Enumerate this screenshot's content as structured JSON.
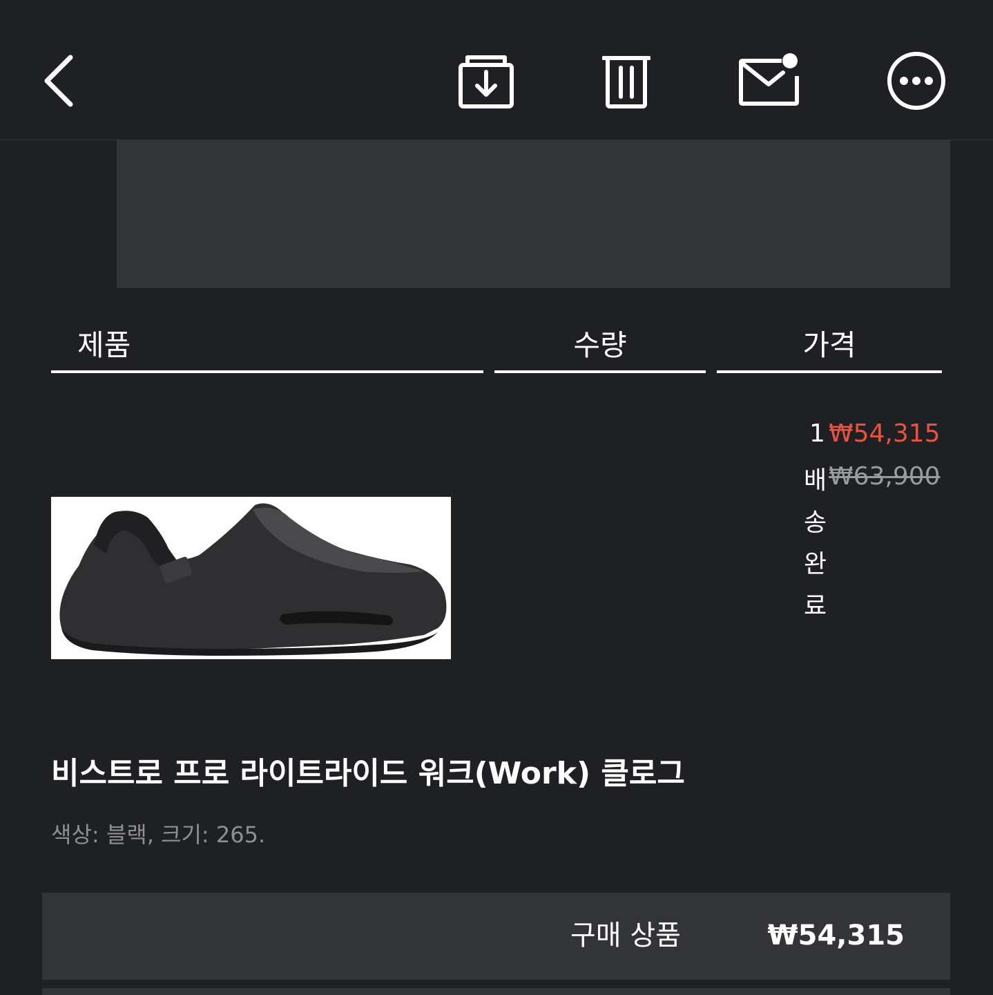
{
  "columns": {
    "product": "제품",
    "quantity": "수량",
    "price": "가격"
  },
  "item": {
    "quantity": "1",
    "price": "₩54,315",
    "original_price": "₩63,900",
    "status": "배송완료",
    "name": "비스트로 프로 라이트라이드 워크(Work) 클로그",
    "options": "색상: 블랙, 크기: 265."
  },
  "summary": {
    "label": "구매 상품",
    "value": "₩54,315"
  },
  "colors": {
    "background": "#1f2023",
    "panel": "#323437",
    "sale_price": "#e8533f"
  },
  "icons": [
    "back-icon",
    "archive-icon",
    "trash-icon",
    "mail-unread-icon",
    "more-icon"
  ]
}
